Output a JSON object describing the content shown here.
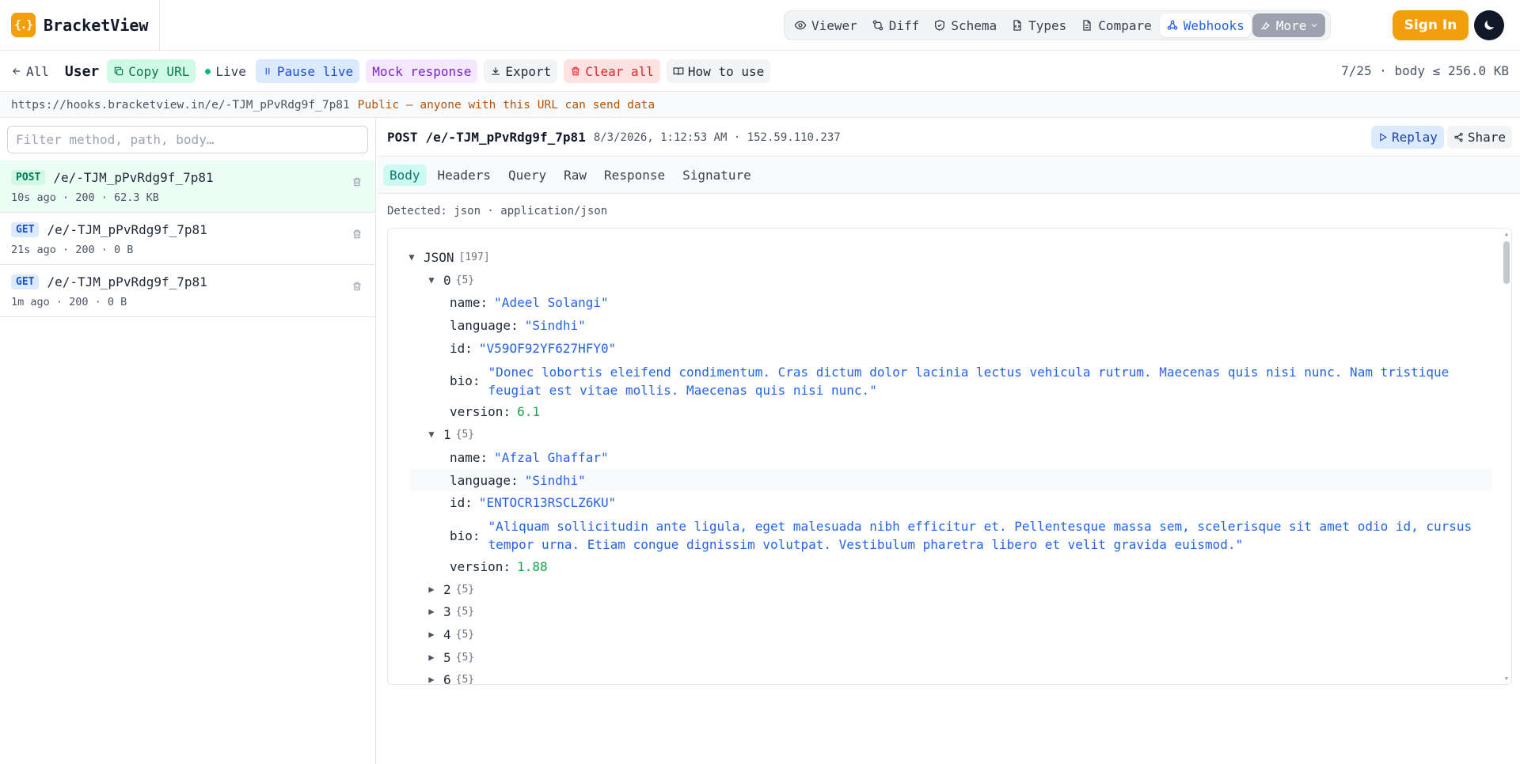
{
  "brand": {
    "logo": "{.}",
    "name": "BracketView"
  },
  "nav": {
    "items": [
      {
        "label": "Viewer",
        "icon": "eye-icon"
      },
      {
        "label": "Diff",
        "icon": "git-compare-icon"
      },
      {
        "label": "Schema",
        "icon": "shield-icon"
      },
      {
        "label": "Types",
        "icon": "file-code-icon"
      },
      {
        "label": "Compare",
        "icon": "file-text-icon"
      },
      {
        "label": "Webhooks",
        "icon": "webhook-icon",
        "active": true
      },
      {
        "label": "More",
        "icon": "wrench-icon"
      }
    ],
    "sign_in": "Sign In",
    "theme_icon": "moon-icon"
  },
  "toolbar": {
    "back_label": "All",
    "title": "User",
    "copy_url": "Copy URL",
    "live": "Live",
    "pause_live": "Pause live",
    "mock_response": "Mock response",
    "export": "Export",
    "clear_all": "Clear all",
    "how_to_use": "How to use",
    "limits": "7/25 · body ≤ 256.0 KB"
  },
  "urlbar": {
    "url": "https://hooks.bracketview.in/e/-TJM_pPvRdg9f_7p81",
    "note": "Public — anyone with this URL can send data"
  },
  "filter": {
    "placeholder": "Filter method, path, body…"
  },
  "requests": [
    {
      "method": "POST",
      "path": "/e/-TJM_pPvRdg9f_7p81",
      "meta": "10s ago · 200 · 62.3 KB"
    },
    {
      "method": "GET",
      "path": "/e/-TJM_pPvRdg9f_7p81",
      "meta": "21s ago · 200 · 0 B"
    },
    {
      "method": "GET",
      "path": "/e/-TJM_pPvRdg9f_7p81",
      "meta": "1m ago · 200 · 0 B"
    }
  ],
  "detail": {
    "method": "POST",
    "path": "/e/-TJM_pPvRdg9f_7p81",
    "info": "8/3/2026, 1:12:53 AM · 152.59.110.237",
    "replay": "Replay",
    "share": "Share",
    "tabs": [
      "Body",
      "Headers",
      "Query",
      "Raw",
      "Response",
      "Signature"
    ],
    "active_tab": "Body",
    "detected": "Detected: json · application/json"
  },
  "json_tree": {
    "root_label": "JSON",
    "root_count": "[197]",
    "items": [
      {
        "index": "0",
        "count": "{5}",
        "name": "\"Adeel Solangi\"",
        "language": "\"Sindhi\"",
        "id": "\"V59OF92YF627HFY0\"",
        "bio": "\"Donec lobortis eleifend condimentum. Cras dictum dolor lacinia lectus vehicula rutrum. Maecenas quis nisi nunc. Nam tristique feugiat est vitae mollis. Maecenas quis nisi nunc.\"",
        "version": "6.1"
      },
      {
        "index": "1",
        "count": "{5}",
        "name": "\"Afzal Ghaffar\"",
        "language": "\"Sindhi\"",
        "id": "\"ENTOCR13RSCLZ6KU\"",
        "bio": "\"Aliquam sollicitudin ante ligula, eget malesuada nibh efficitur et. Pellentesque massa sem, scelerisque sit amet odio id, cursus tempor urna. Etiam congue dignissim volutpat. Vestibulum pharetra libero et velit gravida euismod.\"",
        "version": "1.88"
      }
    ],
    "collapsed": [
      {
        "index": "2",
        "count": "{5}"
      },
      {
        "index": "3",
        "count": "{5}"
      },
      {
        "index": "4",
        "count": "{5}"
      },
      {
        "index": "5",
        "count": "{5}"
      },
      {
        "index": "6",
        "count": "{5}"
      }
    ],
    "keys": {
      "name": "name",
      "language": "language",
      "id": "id",
      "bio": "bio",
      "version": "version"
    }
  }
}
